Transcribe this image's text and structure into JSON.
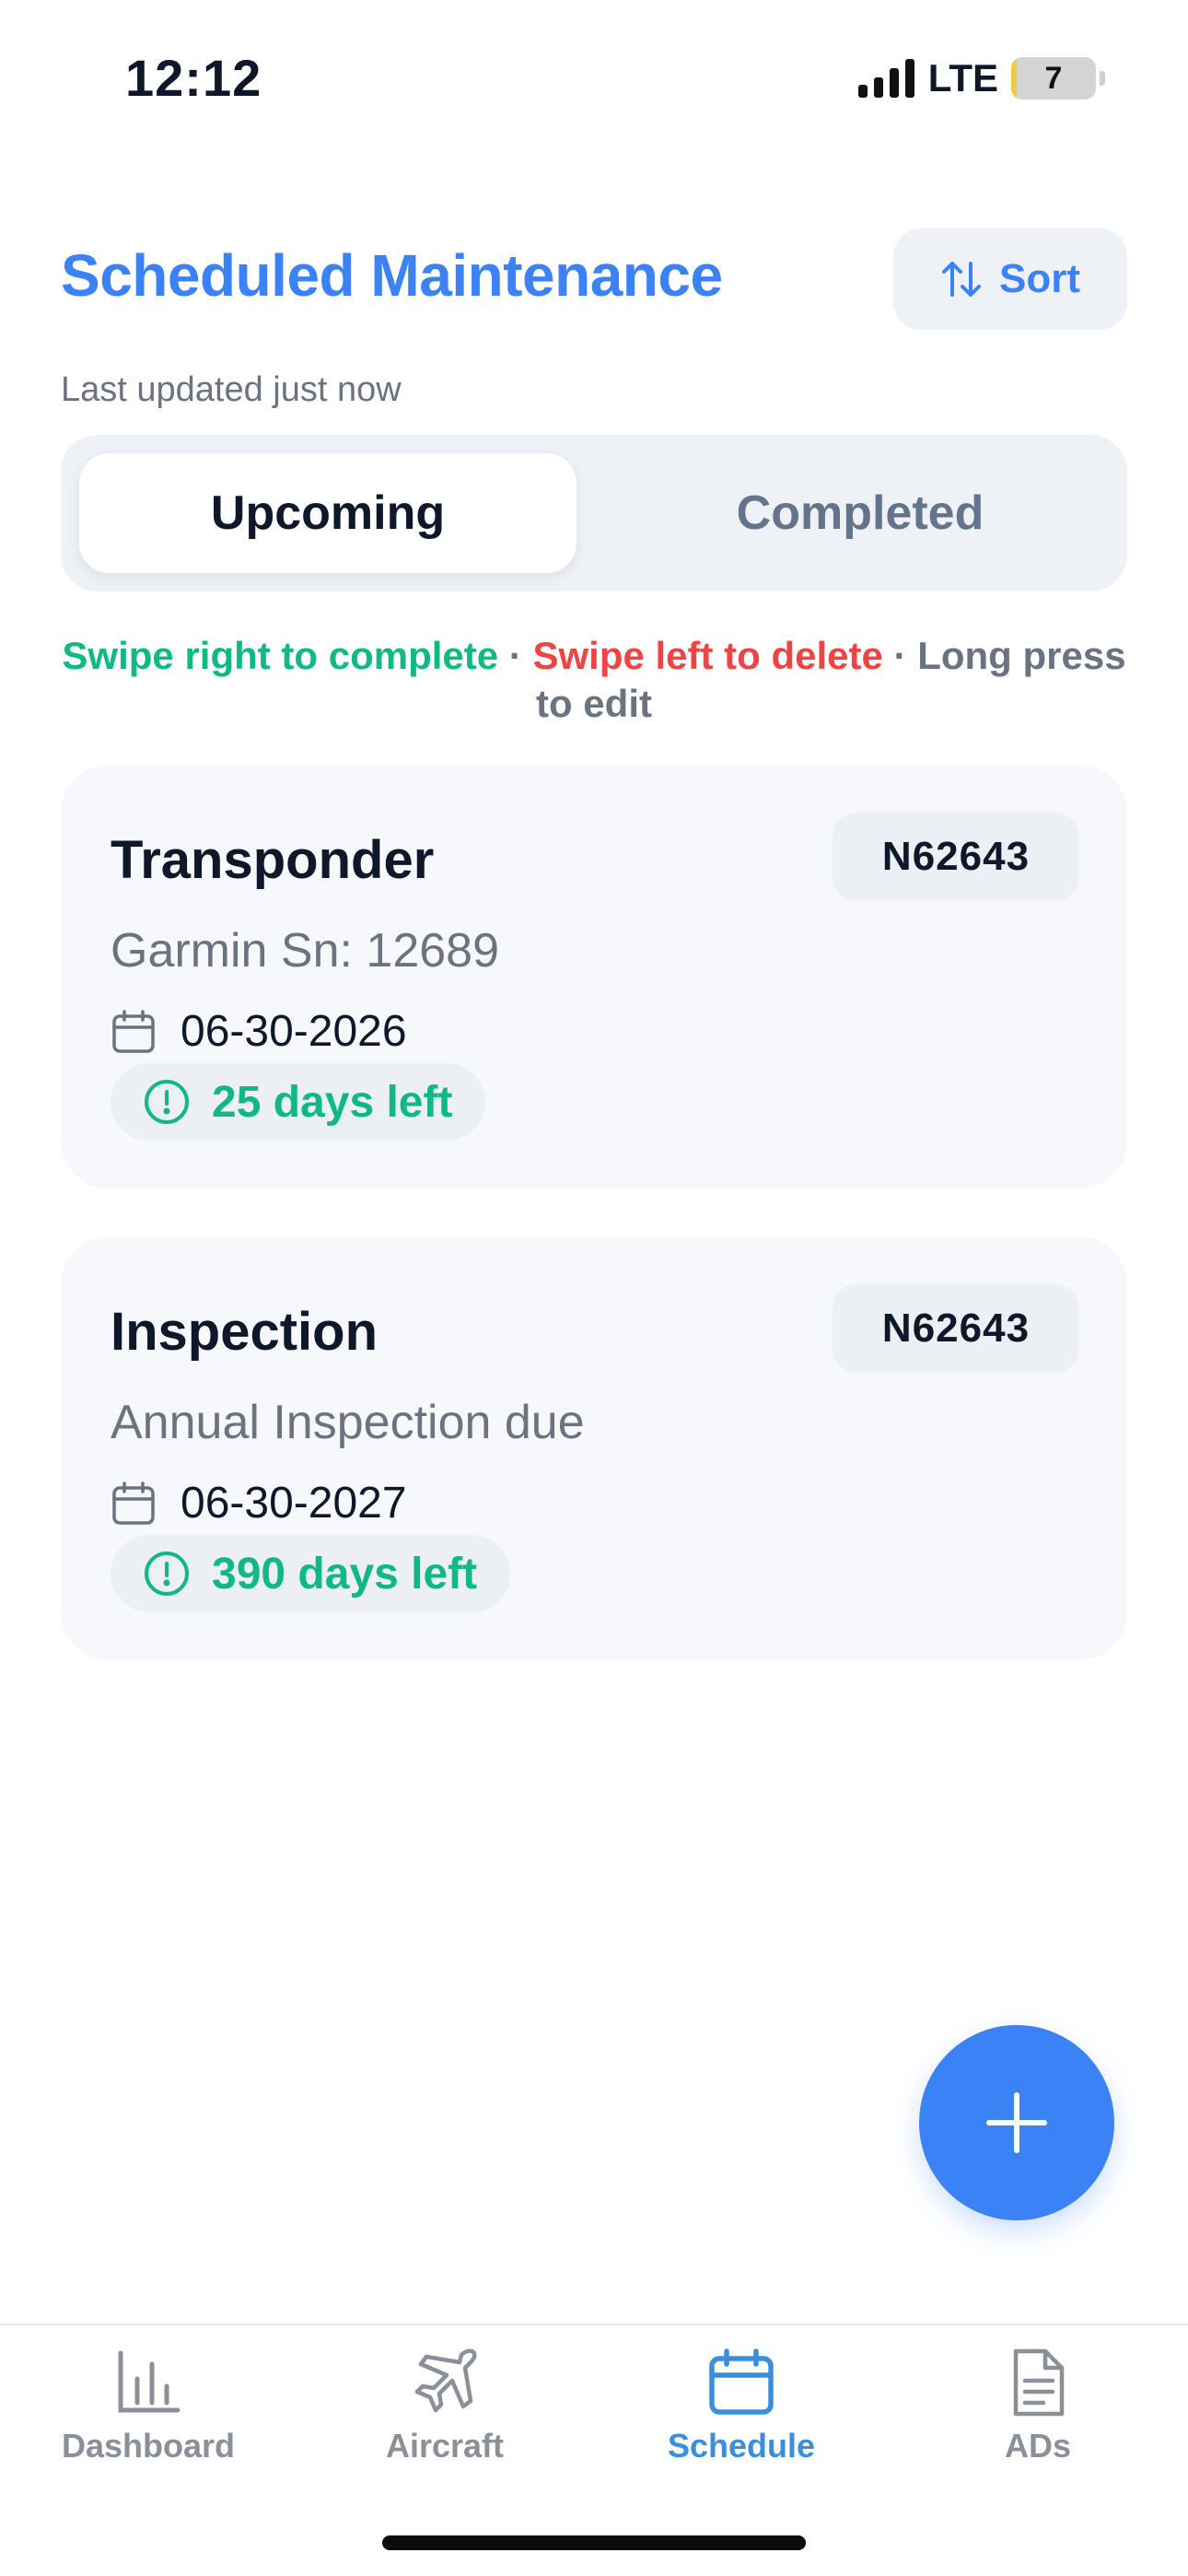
{
  "status_bar": {
    "time": "12:12",
    "network": "LTE",
    "battery_level": "7",
    "battery_fraction": 0.07
  },
  "header": {
    "title": "Scheduled Maintenance",
    "sort_label": "Sort",
    "last_updated": "Last updated just now"
  },
  "tabs": {
    "upcoming": "Upcoming",
    "completed": "Completed",
    "active": "upcoming"
  },
  "hint": {
    "complete": "Swipe right to complete",
    "sep1": " · ",
    "delete": "Swipe left to delete",
    "rest": " · Long press to edit"
  },
  "cards": [
    {
      "title": "Transponder",
      "tail": "N62643",
      "subtitle": "Garmin Sn: 12689",
      "date": "06-30-2026",
      "days_left": "25 days left"
    },
    {
      "title": "Inspection",
      "tail": "N62643",
      "subtitle": "Annual Inspection due",
      "date": "06-30-2027",
      "days_left": "390 days left"
    }
  ],
  "nav": {
    "dashboard": "Dashboard",
    "aircraft": "Aircraft",
    "schedule": "Schedule",
    "ads": "ADs",
    "active": "schedule"
  },
  "colors": {
    "accent": "#3b82f6",
    "success": "#10b981",
    "danger": "#ef4444",
    "muted": "#6b7280"
  }
}
